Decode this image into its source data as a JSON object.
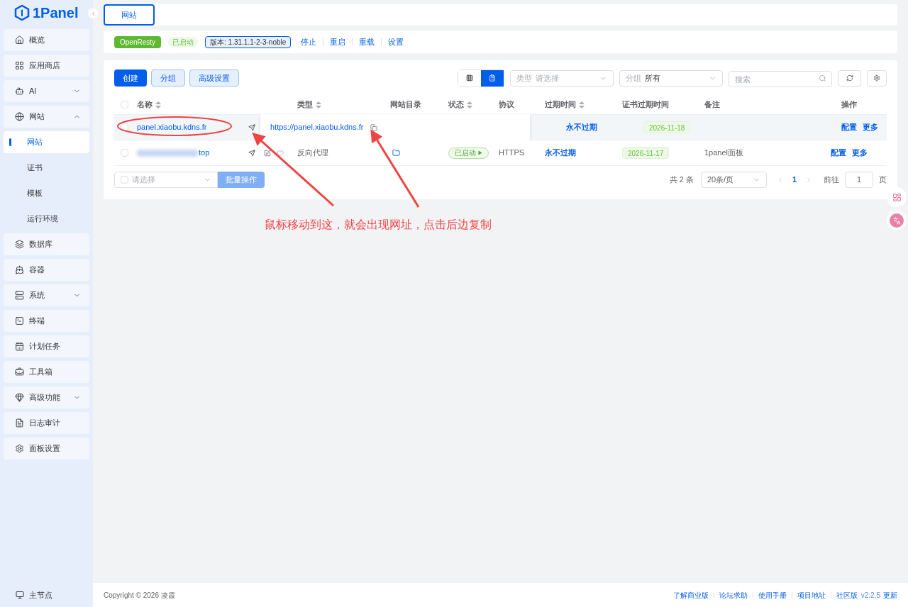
{
  "logo": {
    "text": "1Panel"
  },
  "sidebar": {
    "items": [
      {
        "label": "概览",
        "kind": "link"
      },
      {
        "label": "应用商店",
        "kind": "link"
      },
      {
        "label": "AI",
        "kind": "group",
        "expanded": false
      },
      {
        "label": "网站",
        "kind": "group",
        "expanded": true,
        "children": [
          {
            "label": "网站",
            "selected": true
          },
          {
            "label": "证书",
            "selected": false
          },
          {
            "label": "模板",
            "selected": false
          },
          {
            "label": "运行环境",
            "selected": false
          }
        ]
      },
      {
        "label": "数据库",
        "kind": "link"
      },
      {
        "label": "容器",
        "kind": "link"
      },
      {
        "label": "系统",
        "kind": "group",
        "expanded": false
      },
      {
        "label": "终端",
        "kind": "link"
      },
      {
        "label": "计划任务",
        "kind": "link"
      },
      {
        "label": "工具箱",
        "kind": "link"
      },
      {
        "label": "高级功能",
        "kind": "group",
        "expanded": false
      },
      {
        "label": "日志审计",
        "kind": "link"
      },
      {
        "label": "面板设置",
        "kind": "link"
      }
    ],
    "node": "主节点"
  },
  "tabs": [
    {
      "label": "网站",
      "selected": true
    }
  ],
  "server_bar": {
    "name": "OpenResty",
    "status": "已启动",
    "version": "版本: 1.31.1.1-2-3-noble",
    "actions": [
      "停止",
      "重启",
      "重载",
      "设置"
    ]
  },
  "toolbar": {
    "buttons": [
      "创建",
      "分组",
      "高级设置"
    ],
    "views": [
      {
        "kind": "grid",
        "selected": false
      },
      {
        "kind": "list",
        "selected": true
      }
    ],
    "type_filter": {
      "label": "类型",
      "placeholder": "请选择"
    },
    "group_filter": {
      "label": "分组",
      "value": "所有"
    },
    "search": {
      "placeholder": "搜索"
    }
  },
  "table": {
    "select_all": {
      "checked": false
    },
    "columns": [
      {
        "label": "名称",
        "sortable": true
      },
      {
        "label": "类型",
        "sortable": true
      },
      {
        "label": "网站目录",
        "sortable": false
      },
      {
        "label": "状态",
        "sortable": true
      },
      {
        "label": "协议",
        "sortable": false
      },
      {
        "label": "过期时间",
        "sortable": true
      },
      {
        "label": "证书过期时间",
        "sortable": false
      },
      {
        "label": "备注",
        "sortable": false
      },
      {
        "label": "操作",
        "sortable": false
      }
    ],
    "rows": [
      {
        "name": "panel.xiaobu.kdns.fr",
        "checked": false,
        "blurred": false,
        "hovered": true,
        "popover_url": "https://panel.xiaobu.kdns.fr",
        "expire": "永不过期",
        "cert_expire": "2026-11-18",
        "actions": [
          "配置",
          "更多"
        ]
      },
      {
        "name": "top",
        "checked": false,
        "blurred": true,
        "hovered": false,
        "type": "反向代理",
        "status": "已启动",
        "protocol": "HTTPS",
        "expire": "永不过期",
        "cert_expire": "2026-11-17",
        "note": "1panel面板",
        "actions": [
          "配置",
          "更多"
        ]
      }
    ]
  },
  "batch": {
    "placeholder": "请选择",
    "button": "批量操作"
  },
  "pagination": {
    "total": "共 2 条",
    "page_size": "20条/页",
    "current": "1",
    "goto_label": "前往",
    "goto_value": "1",
    "page_label": "页"
  },
  "annotation": {
    "text": "鼠标移动到这，就会出现网址，点击后边复制"
  },
  "footer": {
    "copyright": "Copyright © 2026 凌霞",
    "links": [
      "了解商业版",
      "论坛求助",
      "使用手册",
      "项目地址",
      "社区版"
    ],
    "version": "v2.2.5",
    "update": "更新"
  }
}
